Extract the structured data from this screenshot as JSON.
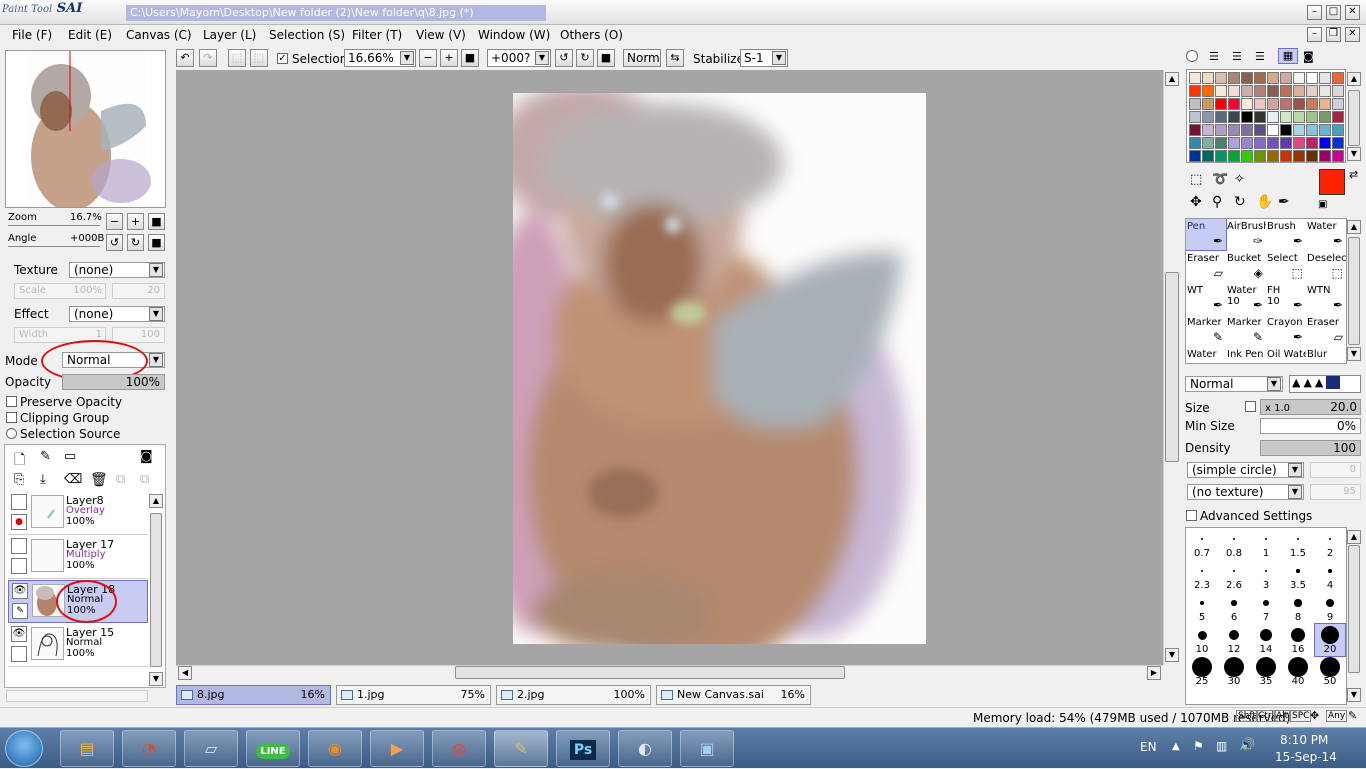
{
  "app": {
    "logo_small": "Paint Tool",
    "logo_big": "SAI",
    "title": "C:\\Users\\Mayom\\Desktop\\New folder (2)\\New folder\\q\\8.jpg (*)"
  },
  "menu": [
    "File (F)",
    "Edit (E)",
    "Canvas (C)",
    "Layer (L)",
    "Selection (S)",
    "Filter (T)",
    "View (V)",
    "Window (W)",
    "Others (O)"
  ],
  "toolbar": {
    "selection_label": "Selection",
    "selection_checked": true,
    "zoom": "16.66%",
    "angle": "+000?",
    "blend": "Normal",
    "stabilizer_label": "Stabilizer",
    "stabilizer": "S-1"
  },
  "navigator": {
    "zoom_label": "Zoom",
    "zoom_value": "16.7%",
    "angle_label": "Angle",
    "angle_value": "+000B"
  },
  "layer_props": {
    "texture_label": "Texture",
    "texture_value": "(none)",
    "scale_label": "Scale",
    "scale_value": "100%",
    "scale_num": "20",
    "effect_label": "Effect",
    "effect_value": "(none)",
    "width_label": "Width",
    "width_value": "1",
    "width_num": "100",
    "mode_label": "Mode",
    "mode_value": "Normal",
    "opacity_label": "Opacity",
    "opacity_value": "100%",
    "preserve_opacity": "Preserve Opacity",
    "clipping_group": "Clipping Group",
    "selection_source": "Selection Source"
  },
  "layers": [
    {
      "name": "Layer8",
      "mode": "Overlay",
      "opacity": "100%",
      "mode_color": "#8a2a9a",
      "selected": false
    },
    {
      "name": "Layer 17",
      "mode": "Multiply",
      "opacity": "100%",
      "mode_color": "#8a2a9a",
      "selected": false
    },
    {
      "name": "Layer 18",
      "mode": "Normal",
      "opacity": "100%",
      "mode_color": "#000000",
      "selected": true
    },
    {
      "name": "Layer 15",
      "mode": "Normal",
      "opacity": "100%",
      "mode_color": "#000000",
      "selected": false
    }
  ],
  "doc_tabs": [
    {
      "name": "8.jpg",
      "zoom": "16%",
      "active": true
    },
    {
      "name": "1.jpg",
      "zoom": "75%",
      "active": false
    },
    {
      "name": "2.jpg",
      "zoom": "100%",
      "active": false
    },
    {
      "name": "New Canvas.sai",
      "zoom": "16%",
      "active": false
    }
  ],
  "tools": [
    {
      "name": "Pen",
      "icon": "pen-icon",
      "glyph": "✒"
    },
    {
      "name": "AirBrush",
      "icon": "airbrush-icon",
      "glyph": "✑"
    },
    {
      "name": "Brush",
      "icon": "brush-icon",
      "glyph": "✒"
    },
    {
      "name": "Water",
      "icon": "water-brush-icon",
      "glyph": "✒"
    },
    {
      "name": "Eraser",
      "icon": "eraser-icon",
      "glyph": "▱"
    },
    {
      "name": "Bucket",
      "icon": "bucket-icon",
      "glyph": "◈"
    },
    {
      "name": "Select",
      "icon": "select-icon",
      "glyph": "⬚"
    },
    {
      "name": "Deselect",
      "icon": "deselect-icon",
      "glyph": "⬚"
    },
    {
      "name": "WT",
      "icon": "pen-icon",
      "glyph": "✒"
    },
    {
      "name": "Water\n10",
      "icon": "water-brush-icon",
      "glyph": "✒"
    },
    {
      "name": "FH\n10",
      "icon": "pen-icon",
      "glyph": "✒"
    },
    {
      "name": "WTN",
      "icon": "pen-icon",
      "glyph": "✒"
    },
    {
      "name": "Marker",
      "icon": "marker-icon",
      "glyph": "✎"
    },
    {
      "name": "Marker",
      "icon": "marker-icon",
      "glyph": "✎"
    },
    {
      "name": "Crayon",
      "icon": "crayon-icon",
      "glyph": "✒"
    },
    {
      "name": "Eraser",
      "icon": "eraser-icon",
      "glyph": "▱"
    },
    {
      "name": "Water",
      "icon": "water-brush-icon",
      "glyph": ""
    },
    {
      "name": "Ink Pen",
      "icon": "pen-icon",
      "glyph": ""
    },
    {
      "name": "Oil Wate",
      "icon": "brush-icon",
      "glyph": ""
    },
    {
      "name": "Blur",
      "icon": "blur-icon",
      "glyph": ""
    }
  ],
  "brush": {
    "blend": "Normal",
    "size_label": "Size",
    "size_mult": "x 1.0",
    "size_value": "20.0",
    "minsize_label": "Min Size",
    "minsize_value": "0%",
    "density_label": "Density",
    "density_value": "100",
    "shape": "(simple circle)",
    "shape_num": "0",
    "texture": "(no texture)",
    "texture_num": "95",
    "advanced": "Advanced Settings"
  },
  "brush_sizes": [
    "0.7",
    "0.8",
    "1",
    "1.5",
    "2",
    "2.3",
    "2.6",
    "3",
    "3.5",
    "4",
    "5",
    "6",
    "7",
    "8",
    "9",
    "10",
    "12",
    "14",
    "16",
    "20",
    "25",
    "30",
    "35",
    "40",
    "50"
  ],
  "brush_selected": "20",
  "colors": {
    "primary": "#ff2200",
    "secondary": "#ecefe4",
    "canvas_bg": "#a5a5a5",
    "accent": "#b3b8e3"
  },
  "status": {
    "memory": "Memory load: 54% (479MB used / 1070MB reserved)",
    "keys": [
      "Shft",
      "Ctrl",
      "Alt",
      "SPC"
    ],
    "any": "Any"
  },
  "taskbar": {
    "lang": "EN",
    "time": "8:10 PM",
    "date": "15-Sep-14",
    "ps_label": "Ps",
    "line_label": "LINE"
  }
}
